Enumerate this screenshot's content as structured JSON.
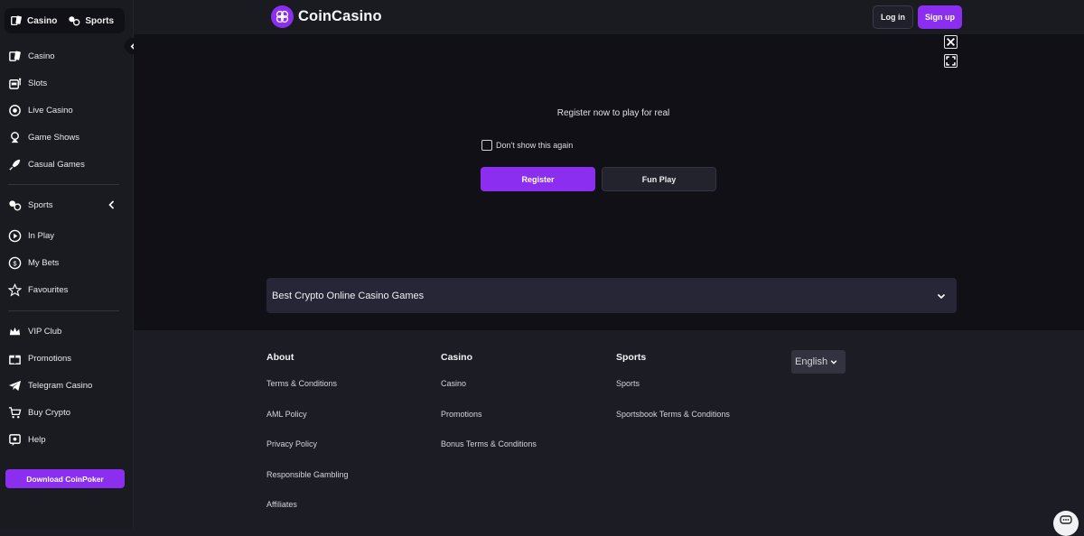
{
  "header": {
    "logo_text": "CoinCasino",
    "login_label": "Log in",
    "signup_label": "Sign up"
  },
  "sidebar": {
    "mode_toggle": {
      "casino": "Casino",
      "sports": "Sports"
    },
    "casino_items": [
      {
        "label": "Casino",
        "icon": "cards-icon"
      },
      {
        "label": "Slots",
        "icon": "slot-machine-icon"
      },
      {
        "label": "Live Casino",
        "icon": "live-casino-icon"
      },
      {
        "label": "Game Shows",
        "icon": "game-show-icon"
      },
      {
        "label": "Casual Games",
        "icon": "rocket-icon"
      }
    ],
    "sports_items": [
      {
        "label": "Sports",
        "icon": "sports-icon"
      },
      {
        "label": "In Play",
        "icon": "play-circle-icon"
      },
      {
        "label": "My Bets",
        "icon": "bets-icon"
      },
      {
        "label": "Favourites",
        "icon": "star-icon"
      }
    ],
    "extra_items": [
      {
        "label": "VIP Club",
        "icon": "crown-icon"
      },
      {
        "label": "Promotions",
        "icon": "gift-icon"
      },
      {
        "label": "Telegram Casino",
        "icon": "telegram-icon"
      },
      {
        "label": "Buy Crypto",
        "icon": "cart-icon"
      },
      {
        "label": "Help",
        "icon": "help-icon"
      }
    ],
    "download_label": "Download CoinPoker"
  },
  "game": {
    "prompt": "Register now to play for real",
    "dont_show": "Don't show this again",
    "dont_show_checked": false,
    "register_label": "Register",
    "funplay_label": "Fun Play"
  },
  "accordion": {
    "title": "Best Crypto Online Casino Games"
  },
  "footer": {
    "columns": [
      {
        "heading": "About",
        "links": [
          "Terms & Conditions",
          "AML Policy",
          "Privacy Policy",
          "Responsible Gambling",
          "Affiliates"
        ]
      },
      {
        "heading": "Casino",
        "links": [
          "Casino",
          "Promotions",
          "Bonus Terms & Conditions"
        ]
      },
      {
        "heading": "Sports",
        "links": [
          "Sports",
          "Sportsbook Terms & Conditions"
        ]
      }
    ],
    "language": "English"
  },
  "colors": {
    "accent": "#8b2ef0",
    "sidebar_bg": "#1a1a21",
    "game_bg": "#101016",
    "footer_bg": "#1c1c24",
    "accordion_bg": "#262637"
  }
}
